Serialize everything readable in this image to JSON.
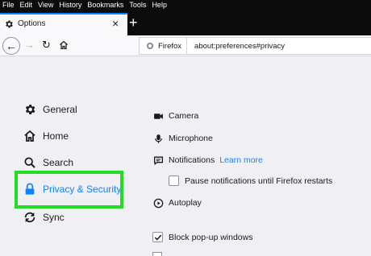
{
  "menubar": {
    "items": [
      "File",
      "Edit",
      "View",
      "History",
      "Bookmarks",
      "Tools",
      "Help"
    ]
  },
  "tab": {
    "title": "Options",
    "close": "×",
    "newtab": "+"
  },
  "nav": {
    "back": "←",
    "forward": "→",
    "reload": "↻",
    "identity_label": "Firefox",
    "url": "about:preferences#privacy"
  },
  "sidebar": {
    "items": [
      {
        "label": "General",
        "icon": "gear-icon"
      },
      {
        "label": "Home",
        "icon": "home-icon"
      },
      {
        "label": "Search",
        "icon": "search-icon"
      },
      {
        "label": "Privacy & Security",
        "icon": "lock-icon",
        "selected": true
      },
      {
        "label": "Sync",
        "icon": "sync-icon"
      }
    ]
  },
  "permissions": {
    "camera": "Camera",
    "microphone": "Microphone",
    "notifications": "Notifications",
    "learn_more": "Learn more",
    "pause_notifications": "Pause notifications until Firefox restarts",
    "autoplay": "Autoplay",
    "block_popups": "Block pop-up windows"
  },
  "colors": {
    "accent": "#0a84ff",
    "highlight": "#22dd22",
    "chrome_dark": "#0c0c0d"
  },
  "checkboxes": {
    "pause_notifications_checked": false,
    "block_popups_checked": true
  }
}
